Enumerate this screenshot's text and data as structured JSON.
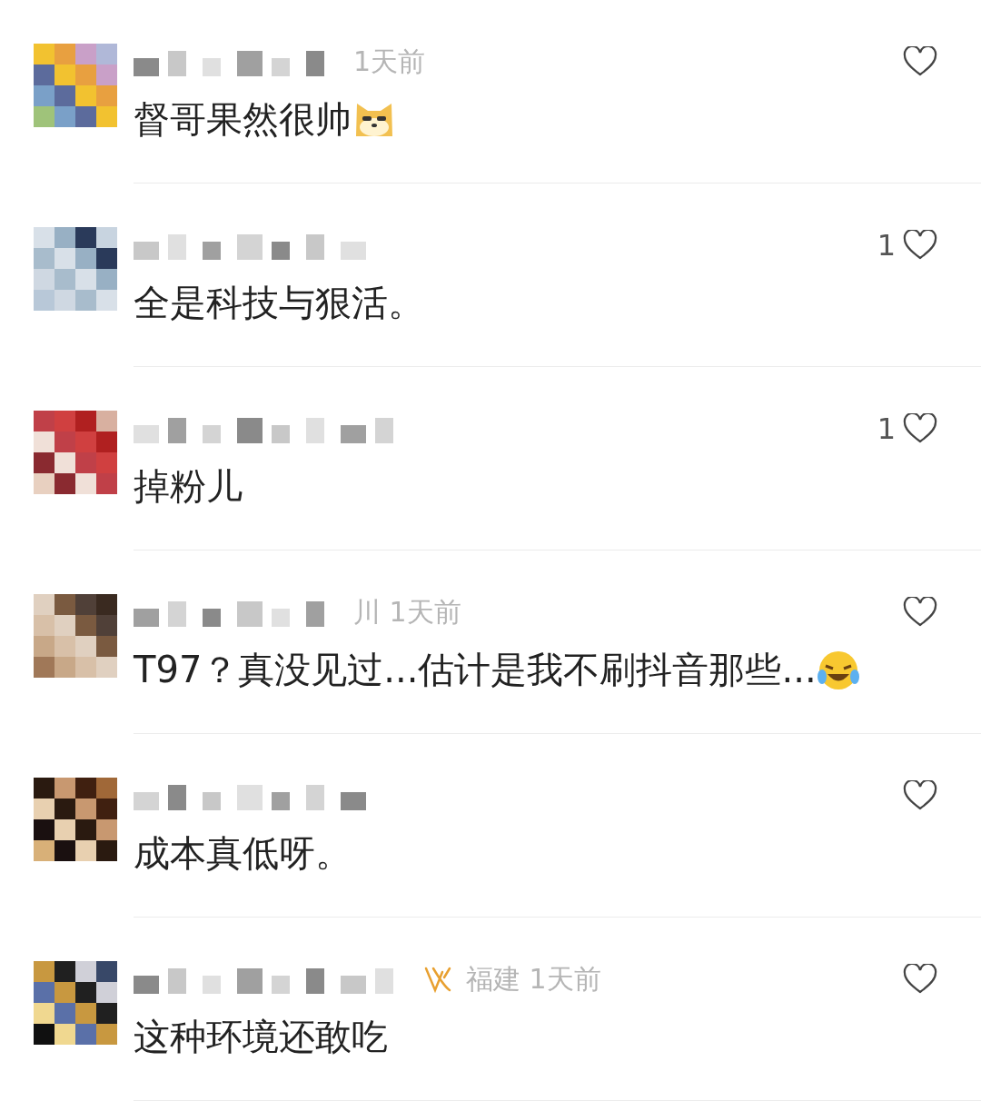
{
  "comments": [
    {
      "meta": "1天前",
      "badge": false,
      "text": "督哥果然很帅",
      "emoji": {
        "kind": "doge"
      }
    },
    {
      "likes": "1",
      "badge": false,
      "text": "全是科技与狠活。"
    },
    {
      "likes": "1",
      "badge": false,
      "text": "掉粉儿"
    },
    {
      "meta": "川 1天前",
      "badge": false,
      "text": "T97？真没见过...估计是我不刷抖音那些...",
      "emoji": {
        "kind": "laugh"
      }
    },
    {
      "badge": false,
      "text": "成本真低呀。"
    },
    {
      "meta": "福建 1天前",
      "badge": true,
      "text": "这种环境还敢吃"
    }
  ]
}
